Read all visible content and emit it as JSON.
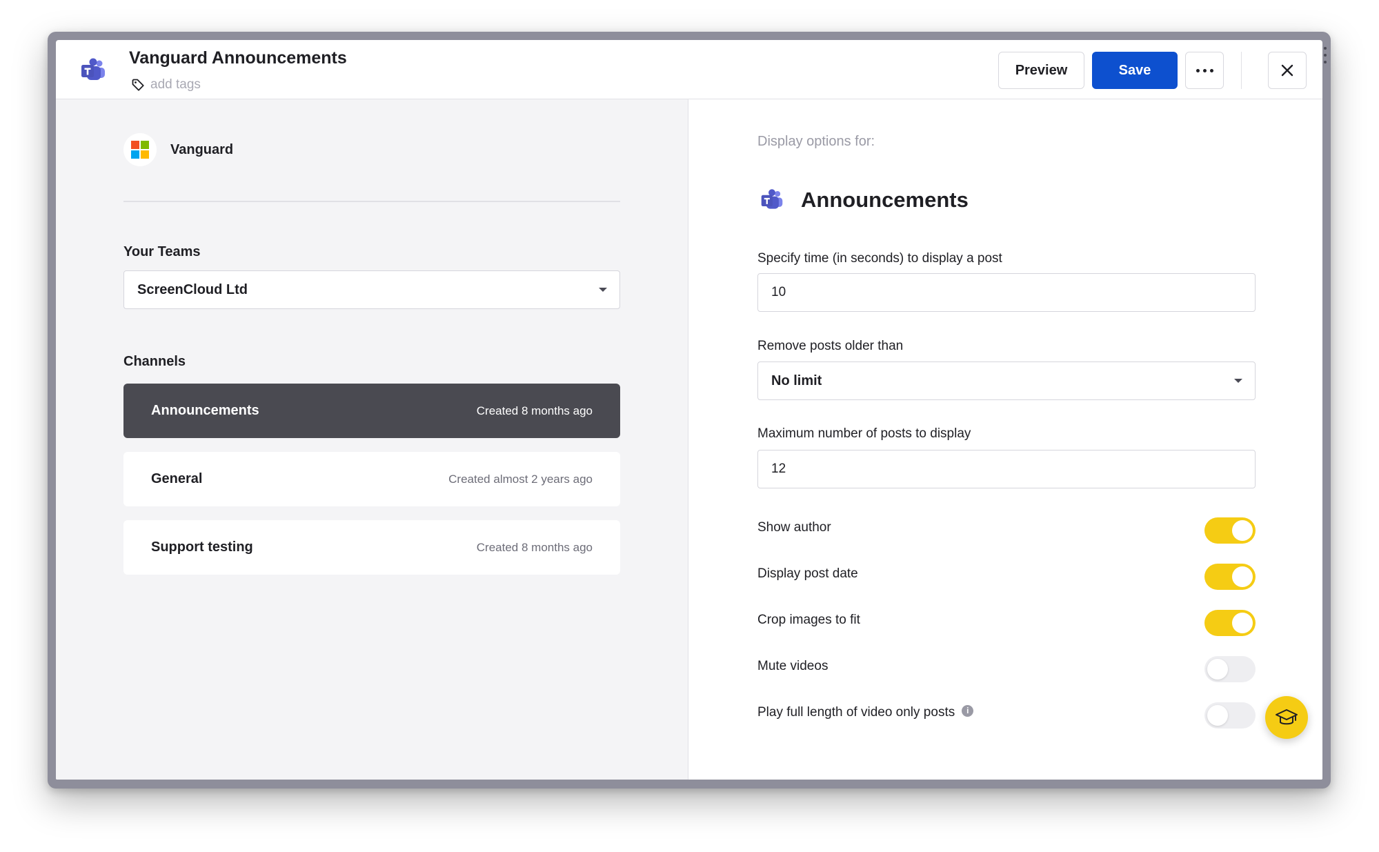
{
  "header": {
    "title": "Vanguard Announcements",
    "tags_placeholder": "add tags",
    "preview_label": "Preview",
    "save_label": "Save"
  },
  "colors": {
    "accent": "#0d50cf",
    "toggle_on": "#f5cc14",
    "active_channel": "#4a4a51"
  },
  "icons": {
    "app": "teams-icon",
    "tag": "tag-icon",
    "more": "more-icon",
    "close": "close-icon",
    "org": "microsoft-logo-icon",
    "help": "graduation-cap-icon"
  },
  "left": {
    "org_name": "Vanguard",
    "teams_label": "Your Teams",
    "team_selected": "ScreenCloud Ltd",
    "channels_label": "Channels",
    "channels": [
      {
        "name": "Announcements",
        "meta": "Created 8 months ago",
        "active": true
      },
      {
        "name": "General",
        "meta": "Created almost 2 years ago",
        "active": false
      },
      {
        "name": "Support testing",
        "meta": "Created 8 months ago",
        "active": false
      }
    ]
  },
  "right": {
    "caption": "Display options for:",
    "channel_title": "Announcements",
    "time_label": "Specify time (in seconds) to display a post",
    "time_value": "10",
    "remove_label": "Remove posts older than",
    "remove_value": "No limit",
    "max_label": "Maximum number of posts to display",
    "max_value": "12",
    "toggles": [
      {
        "label": "Show author",
        "on": true
      },
      {
        "label": "Display post date",
        "on": true
      },
      {
        "label": "Crop images to fit",
        "on": true
      },
      {
        "label": "Mute videos",
        "on": false
      },
      {
        "label": "Play full length of video only posts",
        "on": false
      }
    ]
  }
}
